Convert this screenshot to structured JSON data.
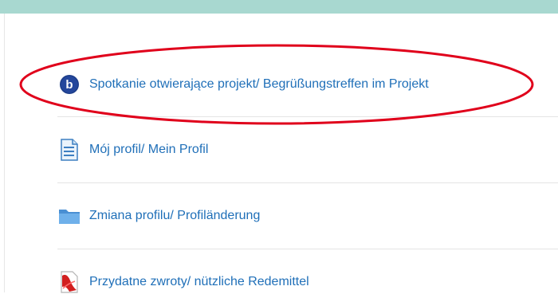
{
  "items": [
    {
      "label": "Spotkanie otwierające projekt/ Begrüßungstreffen im Projekt",
      "icon": "bigbluebutton-icon"
    },
    {
      "label": "Mój profil/ Mein Profil",
      "icon": "page-icon"
    },
    {
      "label": "Zmiana profilu/ Profiländerung",
      "icon": "folder-icon"
    },
    {
      "label": "Przydatne zwroty/ nützliche Redemittel",
      "icon": "pdf-icon"
    }
  ],
  "colors": {
    "link": "#1f6fb8",
    "top_bar": "#a8d8d0",
    "highlight": "#e0001b"
  }
}
